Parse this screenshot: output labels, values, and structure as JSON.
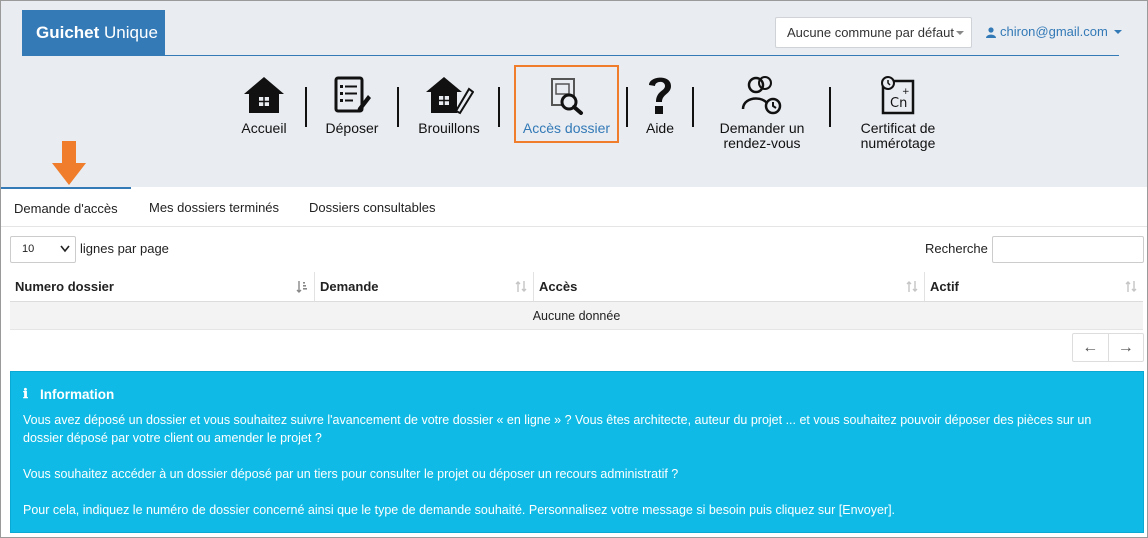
{
  "brand": {
    "bold": "Guichet",
    "rest": "Unique",
    "color": "#337ab7"
  },
  "header": {
    "commune_select": "Aucune commune par défaut",
    "user_email": "chiron@gmail.com"
  },
  "nav": {
    "accueil": "Accueil",
    "deposer": "Déposer",
    "brouillons": "Brouillons",
    "acces": "Accès dossier",
    "aide": "Aide",
    "rdv_line1": "Demander un",
    "rdv_line2": "rendez-vous",
    "cert_line1": "Certificat de",
    "cert_line2": "numérotage",
    "highlight_color": "#ef7d2b"
  },
  "tabs": {
    "t1": "Demande d'accès",
    "t2": "Mes dossiers terminés",
    "t3": "Dossiers consultables"
  },
  "table_controls": {
    "page_length": "10",
    "page_length_label": "lignes par page",
    "search_label": "Recherche",
    "search_value": ""
  },
  "table": {
    "columns": [
      "Numero dossier",
      "Demande",
      "Accès",
      "Actif"
    ],
    "empty_message": "Aucune donnée"
  },
  "pager": {
    "prev": "←",
    "next": "→"
  },
  "info": {
    "icon": "ℹ",
    "title": "Information",
    "p1": "Vous avez déposé un dossier et vous souhaitez suivre l'avancement de votre dossier « en ligne » ? Vous êtes architecte, auteur du projet ... et vous souhaitez pouvoir déposer des pièces sur un dossier déposé par votre client ou amender le projet ?",
    "p2": "Vous souhaitez accéder à un dossier déposé par un tiers pour consulter le projet ou déposer un recours administratif ?",
    "p3": "Pour cela, indiquez le numéro de dossier concerné ainsi que le type de demande souhaité. Personnalisez votre message si besoin puis cliquez sur [Envoyer].",
    "bg_color": "#0fbbe6"
  }
}
